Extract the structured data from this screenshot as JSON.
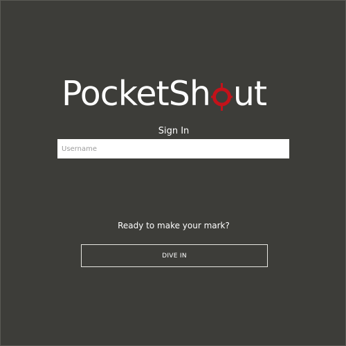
{
  "brand": {
    "name_before_mark": "PocketSh",
    "name_after_mark": "ut",
    "full_name": "PocketShout",
    "mark_icon": "crosshair-target-icon",
    "mark_color": "#c4121a"
  },
  "login": {
    "heading": "Sign In",
    "username_placeholder": "Username",
    "username_value": ""
  },
  "cta": {
    "tagline": "Ready to make your mark?",
    "button_label": "DIVE IN"
  },
  "colors": {
    "background": "#3d3d39",
    "text": "#ffffff",
    "accent": "#c4121a"
  }
}
